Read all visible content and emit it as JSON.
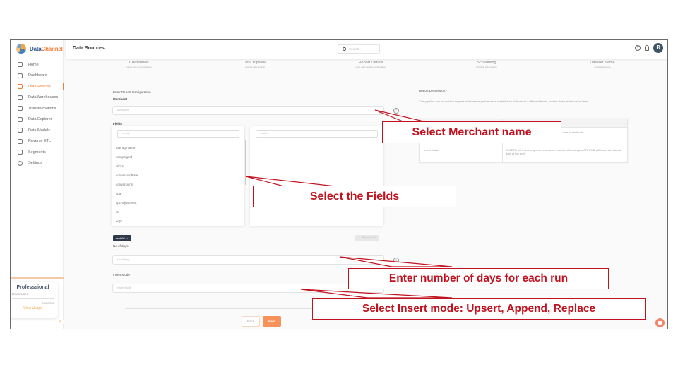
{
  "app": {
    "logo_data": "Data",
    "logo_channel": "Channel"
  },
  "sidebar": {
    "items": [
      {
        "label": "Home",
        "icon": "home-icon",
        "active": false
      },
      {
        "label": "Dashboard",
        "icon": "dashboard-icon",
        "active": false
      },
      {
        "label": "DataSources",
        "icon": "datasources-icon",
        "active": true
      },
      {
        "label": "DataWarehouses",
        "icon": "database-icon",
        "active": false
      },
      {
        "label": "Transformations",
        "icon": "transform-icon",
        "active": false
      },
      {
        "label": "Data Explorer",
        "icon": "explorer-icon",
        "active": false
      },
      {
        "label": "Data Models",
        "icon": "model-icon",
        "active": false
      },
      {
        "label": "Reverse ETL",
        "icon": "reverse-etl-icon",
        "active": false
      },
      {
        "label": "Segments",
        "icon": "segments-icon",
        "active": false
      },
      {
        "label": "Settings",
        "icon": "gear-icon",
        "active": false
      }
    ],
    "plan": {
      "title": "Professsional",
      "rows_label": "Rows Used",
      "usage": "0.96/50M",
      "link": "View Usage"
    },
    "collapse_glyph": "«"
  },
  "header": {
    "title": "Data Sources",
    "search_placeholder": "Search...",
    "help_glyph": "?",
    "avatar_initial": "R"
  },
  "steps": [
    {
      "title": "Credentials",
      "subtitle": "select your account details"
    },
    {
      "title": "Data Pipeline",
      "subtitle": "select a data pipeline"
    },
    {
      "title": "Report Details",
      "subtitle": "enter data pipeline configuration"
    },
    {
      "title": "Scheduling",
      "subtitle": "schedule data pipeline"
    },
    {
      "title": "Dataset Name",
      "subtitle": "set dataset name"
    }
  ],
  "form": {
    "section_title": "Enter Report Configuration",
    "merchant": {
      "label": "Merchant",
      "placeholder": "Merchant"
    },
    "fields": {
      "label": "Fields",
      "left_search_placeholder": "search",
      "right_search_placeholder": "search",
      "available": [
        "averageValue",
        "campaignId",
        "clicks",
        "conversionRate",
        "conversions",
        "cpa",
        "cpcAdjustment",
        "ctr",
        "ecpc"
      ],
      "selected": [],
      "add_all": "Add All →",
      "remove_all": "← Remove All"
    },
    "days": {
      "label": "No of days",
      "placeholder": "No of days"
    },
    "insert_mode": {
      "label": "Insert Mode",
      "placeholder": "Insert Mode"
    },
    "back": "Back",
    "next": "Next"
  },
  "description": {
    "title": "Report Description -",
    "text": "This pipeline can be used to request and retrieve performance statistics by platform at a different levels, broken down at a browser level.",
    "table": {
      "header": [
        "",
        "Description"
      ],
      "rows": [
        [
          "No of days",
          "Enter the number of days you wish to get the data in each run."
        ],
        [
          "Insert Mode",
          "DELETE will insert only new records or records with changes; APPEND will insert all fetched data at the end."
        ]
      ]
    }
  },
  "callouts": {
    "merchant": "Select Merchant name",
    "fields": "Select the Fields",
    "days": "Enter number of days for each run",
    "insert": "Select Insert mode: Upsert, Append, Replace"
  },
  "colors": {
    "accent": "#f27b35",
    "callout": "#c1121f",
    "primary_dark": "#2f3a4c"
  }
}
